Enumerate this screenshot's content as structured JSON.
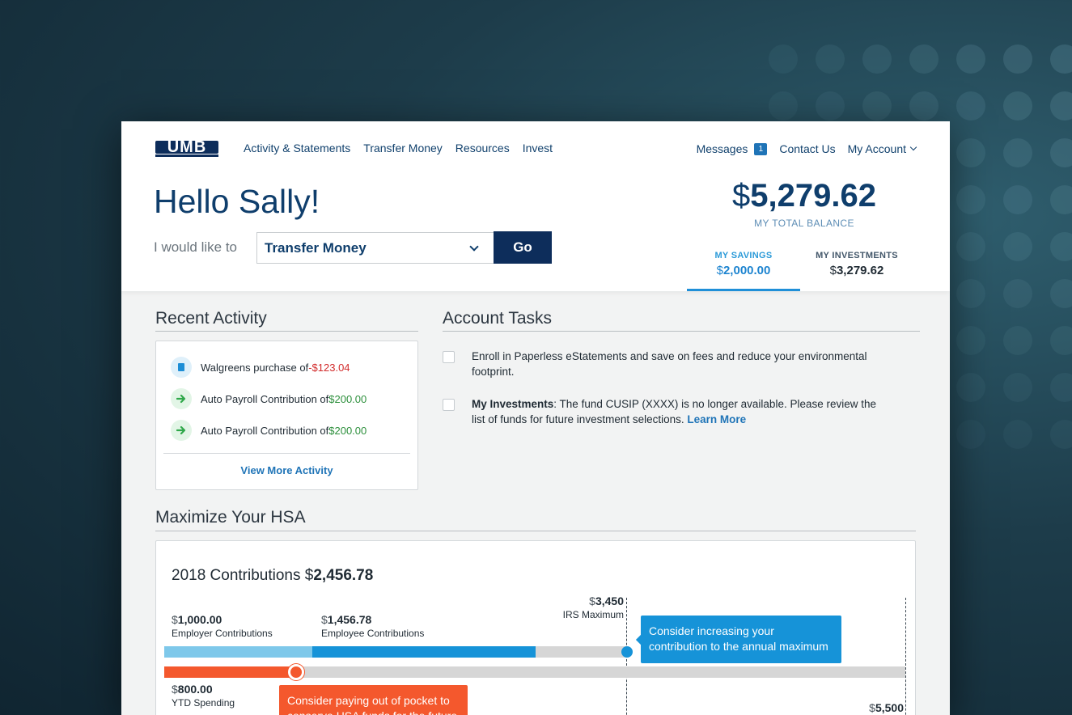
{
  "header": {
    "logo_text": "UMB",
    "nav": [
      "Activity & Statements",
      "Transfer Money",
      "Resources",
      "Invest"
    ],
    "messages_label": "Messages",
    "messages_count": "1",
    "contact_label": "Contact Us",
    "account_label": "My Account"
  },
  "greeting": "Hello Sally!",
  "action": {
    "label": "I would like to",
    "selected": "Transfer Money",
    "go_label": "Go"
  },
  "balance": {
    "currency": "$",
    "total": "5,279.62",
    "total_label": "MY TOTAL BALANCE",
    "savings_label": "MY SAVINGS",
    "savings_value": "2,000.00",
    "investments_label": "MY INVESTMENTS",
    "investments_value": "3,279.62"
  },
  "recent_activity": {
    "title": "Recent Activity",
    "items": [
      {
        "text": "Walgreens purchase of ",
        "amount": "-$123.04",
        "icon": "document-icon"
      },
      {
        "text": "Auto Payroll Contribution of ",
        "amount": "$200.00",
        "icon": "arrow-right-icon"
      },
      {
        "text": "Auto Payroll Contribution of ",
        "amount": "$200.00",
        "icon": "arrow-right-icon"
      }
    ],
    "view_more": "View More Activity"
  },
  "account_tasks": {
    "title": "Account Tasks",
    "task1": "Enroll in Paperless eStatements and save on fees and reduce your environmental footprint.",
    "task2_bold": "My Investments",
    "task2_text": ": The fund CUSIP (XXXX) is no longer available. Please review the list of funds for future investment selections. ",
    "task2_link": "Learn More"
  },
  "hsa": {
    "title": "Maximize Your HSA",
    "contrib_label": "2018 Contributions ",
    "contrib_currency": "$",
    "contrib_value": "2,456.78",
    "employer_value": "1,000.00",
    "employer_label": "Employer Contributions",
    "employee_value": "1,456.78",
    "employee_label": "Employee Contributions",
    "irs_value": "3,450",
    "irs_label": "IRS Maximum",
    "blue_tip": "Consider increasing your contribution to the annual maximum",
    "spending_value": "800.00",
    "spending_label": "YTD Spending",
    "orange_tip": "Consider paying out of pocket to conserve HSA funds for the future",
    "family_max_value": "5,500",
    "colors": {
      "employer": "#7ec8ea",
      "employee": "#1693d8",
      "track": "#d6d6d6",
      "spending": "#f4582d"
    }
  }
}
